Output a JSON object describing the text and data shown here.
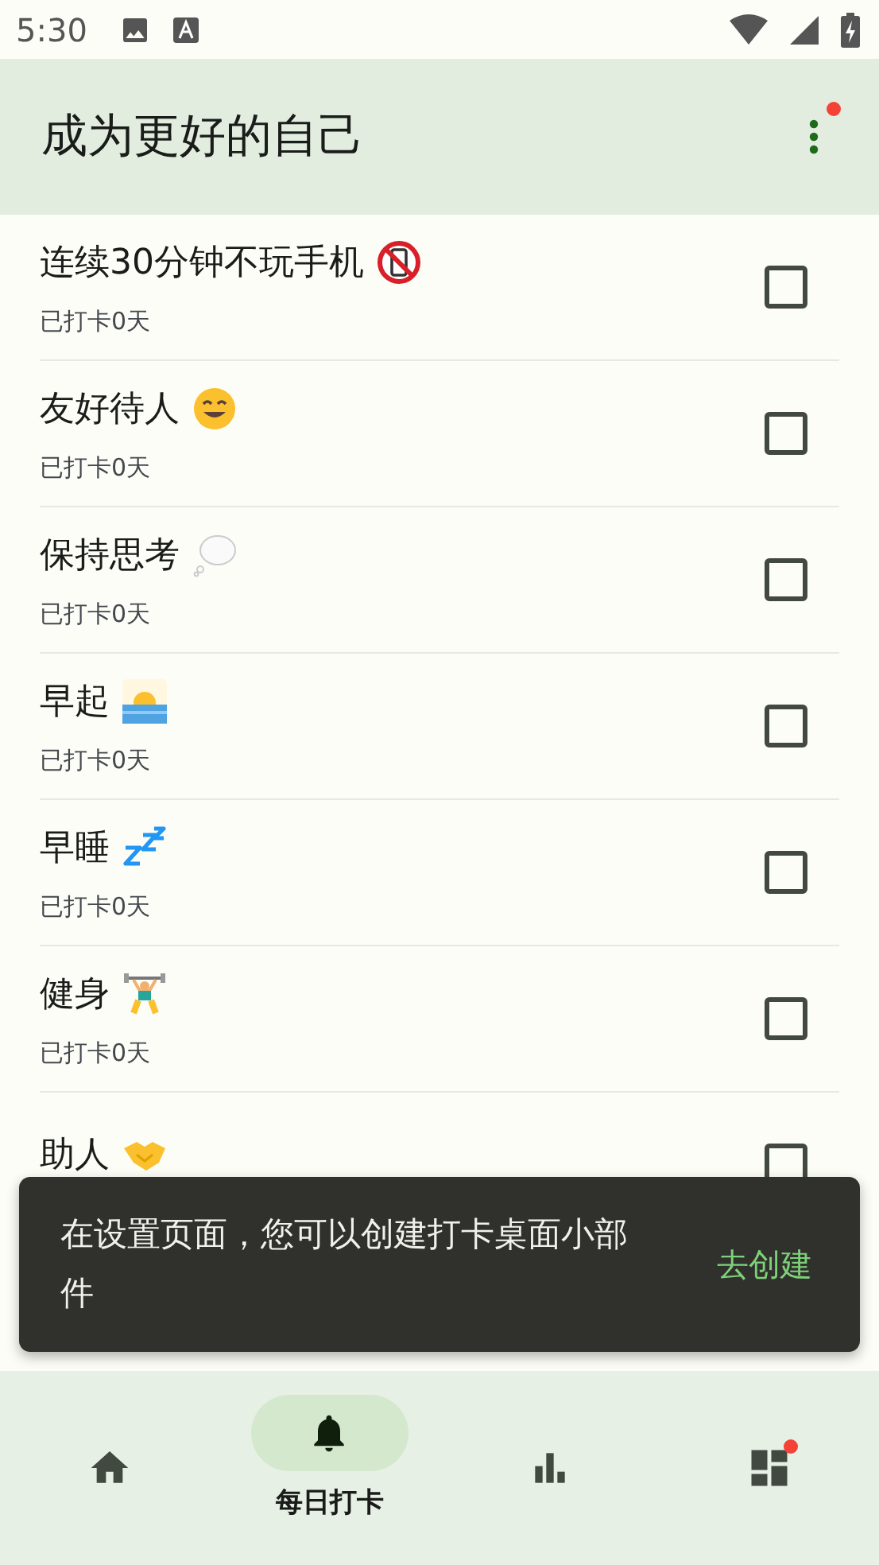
{
  "status_bar": {
    "time": "5:30"
  },
  "app_bar": {
    "title": "成为更好的自己",
    "menu_badge": true
  },
  "habits": [
    {
      "title": "连续30分钟不玩手机",
      "count": "已打卡0天",
      "checked": false
    },
    {
      "title": "友好待人",
      "count": "已打卡0天",
      "checked": false
    },
    {
      "title": "保持思考",
      "count": "已打卡0天",
      "checked": false
    },
    {
      "title": "早起",
      "count": "已打卡0天",
      "checked": false
    },
    {
      "title": "早睡",
      "count": "已打卡0天",
      "checked": false
    },
    {
      "title": "健身",
      "count": "已打卡0天",
      "checked": false
    },
    {
      "title": "助人",
      "checked": false
    }
  ],
  "snackbar": {
    "message": "在设置页面，您可以创建打卡桌面小部件",
    "action": "去创建"
  },
  "bottom_nav": [
    {
      "selected": false,
      "badge": false
    },
    {
      "label": "每日打卡",
      "selected": true,
      "badge": false
    },
    {
      "selected": false,
      "badge": false
    },
    {
      "selected": false,
      "badge": true
    }
  ]
}
